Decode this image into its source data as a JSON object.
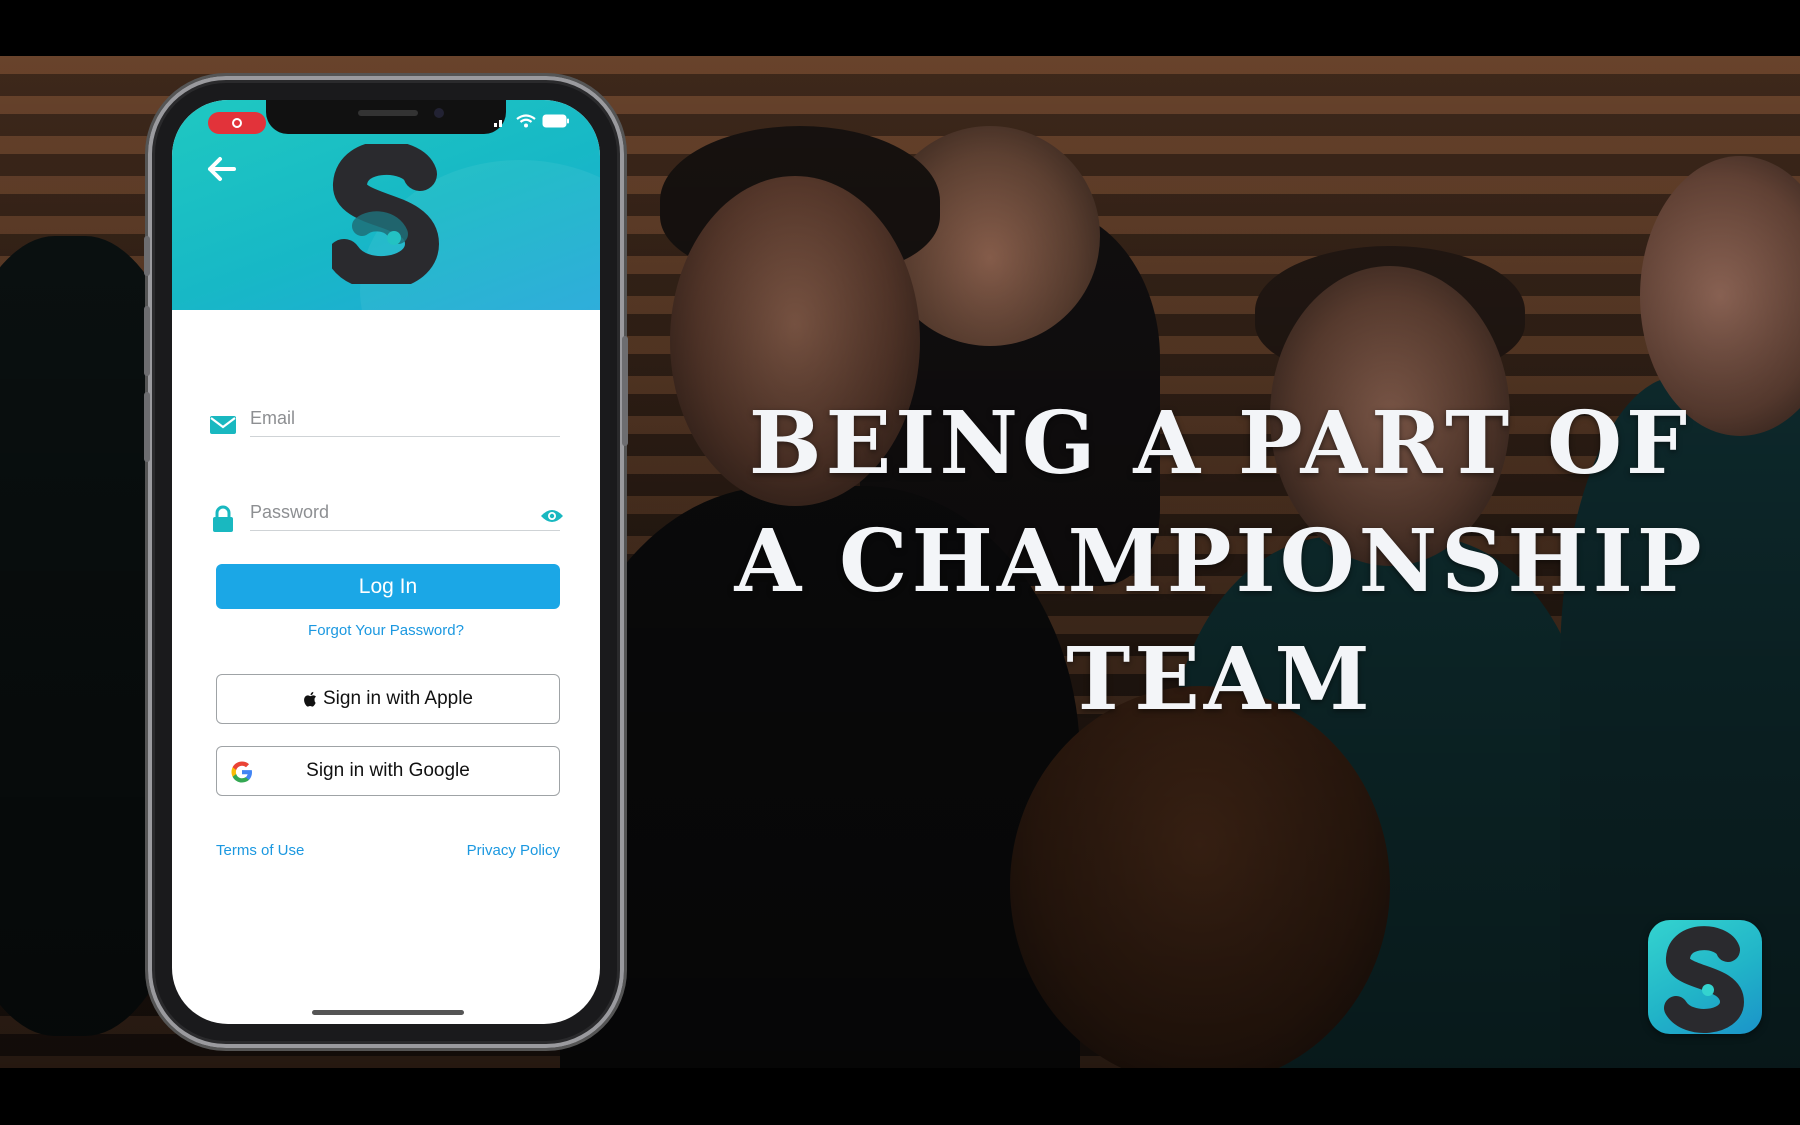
{
  "headline": {
    "line1": "BEING A PART OF",
    "line2": "A CHAMPIONSHIP",
    "line3": "TEAM"
  },
  "login_screen": {
    "email_placeholder": "Email",
    "password_placeholder": "Password",
    "login_label": "Log In",
    "forgot_label": "Forgot Your Password?",
    "apple_label": "Sign in with Apple",
    "google_label": "Sign in with Google",
    "terms_label": "Terms of Use",
    "privacy_label": "Privacy Policy"
  },
  "colors": {
    "accent_teal": "#1fc8c1",
    "button_blue": "#1ba7e6",
    "link_blue": "#1b98e0",
    "record_red": "#e2333a"
  },
  "icons": [
    "back-arrow-icon",
    "app-logo-icon",
    "mail-icon",
    "lock-icon",
    "eye-icon",
    "apple-icon",
    "google-icon",
    "record-icon",
    "signal-icon",
    "wifi-icon",
    "battery-icon"
  ]
}
